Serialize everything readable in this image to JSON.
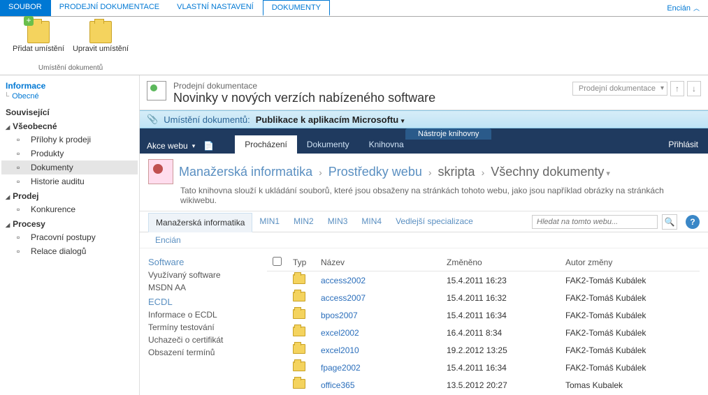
{
  "top_tabs": {
    "file": "SOUBOR",
    "items": [
      "PRODEJNÍ DOKUMENTACE",
      "VLASTNÍ NASTAVENÍ",
      "DOKUMENTY"
    ],
    "active_index": 2,
    "user": "Encián"
  },
  "ribbon": {
    "group_label": "Umístění dokumentů",
    "btn_add": "Přidat umístění",
    "btn_edit": "Upravit umístění"
  },
  "left": {
    "info_head": "Informace",
    "info_sub": "Obecné",
    "related": "Související",
    "groups": [
      {
        "label": "Všeobecné",
        "items": [
          "Přílohy k prodeji",
          "Produkty",
          "Dokumenty",
          "Historie auditu"
        ],
        "selected": 2
      },
      {
        "label": "Prodej",
        "items": [
          "Konkurence"
        ],
        "selected": -1
      },
      {
        "label": "Procesy",
        "items": [
          "Pracovní postupy",
          "Relace dialogů"
        ],
        "selected": -1
      }
    ]
  },
  "header": {
    "sup": "Prodejní dokumentace",
    "title": "Novinky v nových verzích nabízeného software",
    "combo": "Prodejní dokumentace"
  },
  "loc": {
    "label": "Umístění dokumentů:",
    "value": "Publikace k aplikacím Microsoftu"
  },
  "sp": {
    "tools_label": "Nástroje knihovny",
    "actions": "Akce webu",
    "tabs": [
      "Procházení",
      "Dokumenty",
      "Knihovna"
    ],
    "active_tab": 0,
    "login": "Přihlásit"
  },
  "crumb": {
    "parts": [
      "Manažerská informatika",
      "Prostředky webu",
      "skripta",
      "Všechny dokumenty"
    ],
    "desc": "Tato knihovna slouží k ukládání souborů, které jsou obsaženy na stránkách tohoto webu, jako jsou například obrázky na stránkách wikiwebu."
  },
  "subnav": {
    "items": [
      "Manažerská informatika",
      "MIN1",
      "MIN2",
      "MIN3",
      "MIN4",
      "Vedlejší specializace"
    ],
    "active": 0,
    "search_placeholder": "Hledat na tomto webu...",
    "row2": "Encián"
  },
  "content_left": {
    "sections": [
      {
        "head": "Software",
        "items": [
          "Využívaný software",
          "MSDN AA"
        ]
      },
      {
        "head": "ECDL",
        "items": [
          "Informace o ECDL",
          "Termíny testování",
          "Uchazeči o certifikát",
          "Obsazení termínů"
        ]
      }
    ]
  },
  "table": {
    "cols": [
      "Typ",
      "Název",
      "Změněno",
      "Autor změny"
    ],
    "rows": [
      {
        "name": "access2002",
        "date": "15.4.2011 16:23",
        "author": "FAK2-Tomáš Kubálek"
      },
      {
        "name": "access2007",
        "date": "15.4.2011 16:32",
        "author": "FAK2-Tomáš Kubálek"
      },
      {
        "name": "bpos2007",
        "date": "15.4.2011 16:34",
        "author": "FAK2-Tomáš Kubálek"
      },
      {
        "name": "excel2002",
        "date": "16.4.2011 8:34",
        "author": "FAK2-Tomáš Kubálek"
      },
      {
        "name": "excel2010",
        "date": "19.2.2012 13:25",
        "author": "FAK2-Tomáš Kubálek"
      },
      {
        "name": "fpage2002",
        "date": "15.4.2011 16:34",
        "author": "FAK2-Tomáš Kubálek"
      },
      {
        "name": "office365",
        "date": "13.5.2012 20:27",
        "author": "Tomas Kubalek"
      }
    ]
  }
}
